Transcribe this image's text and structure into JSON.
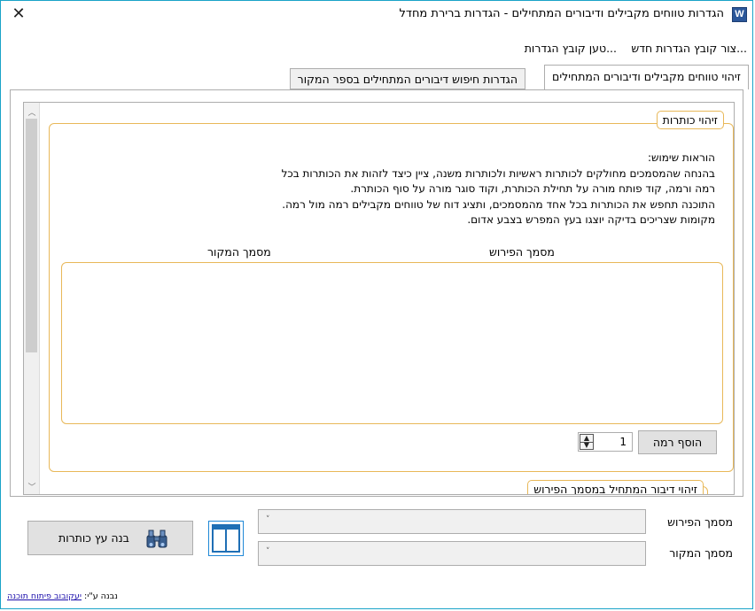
{
  "window": {
    "title": "הגדרות טווחים מקבילים ודיבורים המתחילים - הגדרות ברירת מחדל",
    "app_icon_letter": "W",
    "close_glyph": "✕"
  },
  "menu": {
    "items": [
      "צור קובץ הגדרות חדש...",
      "טען קובץ הגדרות..."
    ]
  },
  "tabs": [
    {
      "label": "זיהוי טווחים מקבילים ודיבורים המתחילים",
      "active": true
    },
    {
      "label": "הגדרות חיפוש דיבורים המתחילים בספר המקור",
      "active": false
    }
  ],
  "headings_group": {
    "legend": "זיהוי כותרות",
    "instructions_title": "הוראות שימוש:",
    "instructions_lines": [
      "בהנחה שהמסמכים מחולקים לכותרות ראשיות ולכותרות משנה, ציין כיצד לזהות את הכותרות בכל",
      "רמה ורמה, קוד פותח מורה על תחילת הכותרת, וקוד סוגר מורה על סוף הכותרת.",
      "התוכנה תחפש את הכותרות בכל אחד מהמסמכים, ותציג דוח של טווחים מקבילים רמה מול רמה.",
      "מקומות שצריכים בדיקה יוצגו בעץ המפרש בצבע אדום."
    ],
    "col_commentary": "מסמך הפירוש",
    "col_source": "מסמך המקור",
    "add_level_label": "הוסף רמה",
    "level_value": "1"
  },
  "second_group": {
    "legend": "זיהוי דיבור המתחיל במסמך הפירוש"
  },
  "bottom": {
    "commentary_label": "מסמך הפירוש",
    "source_label": "מסמך המקור",
    "build_tree_label": "בנה עץ כותרות"
  },
  "footer": {
    "prefix": "נבנה ע\"י:",
    "link": "יעקובוב פיתוח תוכנה"
  },
  "colors": {
    "window_border": "#1aa3c8",
    "groupbox_border": "#e8b859",
    "button_bg": "#e1e1e1",
    "link": "#1a0dab",
    "word_blue": "#2b579a"
  }
}
